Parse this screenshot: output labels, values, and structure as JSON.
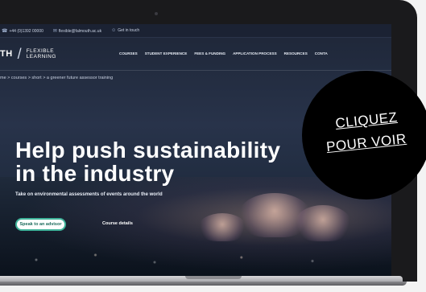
{
  "topbar": {
    "phone_icon": "phone-icon",
    "phone": "+44 (0)1392 00000",
    "mail_icon": "mail-icon",
    "email": "flexible@falmouth.ac.uk",
    "user_icon": "user-icon",
    "login": "Get in touch"
  },
  "brand": {
    "mono": "TH",
    "line1": "FLEXIBLE",
    "line2": "LEARNING"
  },
  "nav": {
    "items": [
      "COURSES",
      "STUDENT EXPERIENCE",
      "FEES & FUNDING",
      "APPLICATION PROCESS",
      "RESOURCES",
      "CONTA"
    ]
  },
  "breadcrumb": "me > courses > short > a greener future assessor training",
  "hero": {
    "headline_line1": "Help push sustainability",
    "headline_line2": "in the industry",
    "subtitle": "Take on environmental assessments of events around the world",
    "primary_cta": "Speak to an advisor",
    "secondary_cta": "Course details"
  },
  "overlay": {
    "line1": "CLIQUEZ",
    "line2": "POUR VOIR"
  },
  "colors": {
    "accent": "#3fb39a",
    "hero_bg": "#28334a",
    "overlay_bg": "#000000"
  }
}
